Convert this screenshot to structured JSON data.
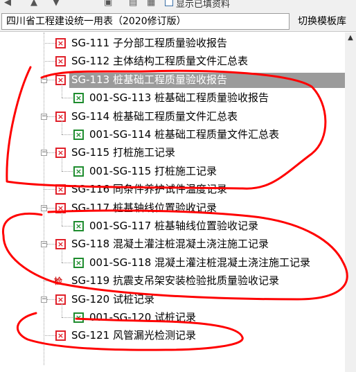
{
  "header": {
    "table_select": "四川省工程建设统一用表（2020修订版）",
    "switch_button": "切换模板库"
  },
  "toolbar": {
    "show_label": "显示已填资料"
  },
  "tree": [
    {
      "code": "SG-111 子分部工程质量验收报告",
      "icon": "red-x",
      "level": 0
    },
    {
      "code": "SG-112 主体结构工程质量文件汇总表",
      "icon": "red-x",
      "level": 0
    },
    {
      "code": "SG-113 桩基础工程质量验收报告",
      "icon": "red-x",
      "level": 0,
      "expanded": true,
      "selected": true
    },
    {
      "code": "001-SG-113 桩基础工程质量验收报告",
      "icon": "green-x",
      "level": 1
    },
    {
      "code": "SG-114 桩基础工程质量文件汇总表",
      "icon": "red-x",
      "level": 0,
      "expanded": true
    },
    {
      "code": "001-SG-114 桩基础工程质量文件汇总表",
      "icon": "green-x",
      "level": 1
    },
    {
      "code": "SG-115 打桩施工记录",
      "icon": "red-x",
      "level": 0,
      "expanded": true
    },
    {
      "code": "001-SG-115 打桩施工记录",
      "icon": "green-x",
      "level": 1
    },
    {
      "code": "SG-116 同条件养护试件温度记录",
      "icon": "red-x",
      "level": 0
    },
    {
      "code": "SG-117 桩基轴线位置验收记录",
      "icon": "red-x",
      "level": 0,
      "expanded": true
    },
    {
      "code": "001-SG-117 桩基轴线位置验收记录",
      "icon": "green-x",
      "level": 1
    },
    {
      "code": "SG-118 混凝土灌注桩混凝土浇注施工记录",
      "icon": "red-x",
      "level": 0,
      "expanded": true
    },
    {
      "code": "001-SG-118 混凝土灌注桩混凝土浇注施工记录",
      "icon": "green-x",
      "level": 1
    },
    {
      "code": "SG-119 抗震支吊架安装检验批质量验收记录",
      "icon": "jian",
      "icon_text": "检",
      "level": 0
    },
    {
      "code": "SG-120 试桩记录",
      "icon": "red-x",
      "level": 0,
      "expanded": true
    },
    {
      "code": "001-SG-120 试桩记录",
      "icon": "green-x",
      "level": 1
    },
    {
      "code": "SG-121 风管漏光检测记录",
      "icon": "red-x",
      "level": 0
    }
  ],
  "colors": {
    "icon_red": "#e0202a",
    "icon_green": "#1e8c2e",
    "selection": "#9b9b9b",
    "annotation": "#ff0000"
  }
}
